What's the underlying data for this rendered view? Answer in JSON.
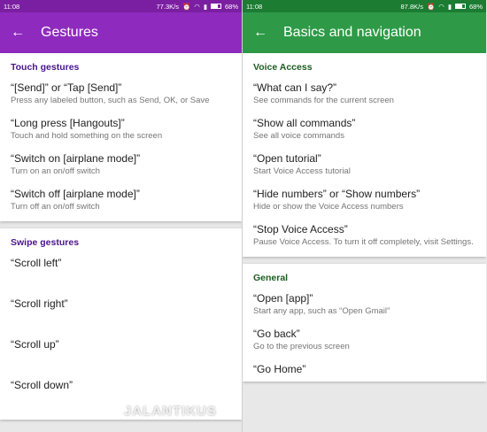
{
  "left": {
    "status": {
      "time": "11:08",
      "speed": "77.3K/s",
      "battery": "68%"
    },
    "title": "Gestures",
    "touch": {
      "header": "Touch gestures",
      "items": [
        {
          "cmd": "“[Send]” or “Tap [Send]”",
          "desc": "Press any labeled button, such as Send, OK, or Save"
        },
        {
          "cmd": "“Long press [Hangouts]”",
          "desc": "Touch and hold something on the screen"
        },
        {
          "cmd": "“Switch on [airplane mode]”",
          "desc": "Turn on an on/off switch"
        },
        {
          "cmd": "“Switch off [airplane mode]”",
          "desc": "Turn off an on/off switch"
        }
      ]
    },
    "swipe": {
      "header": "Swipe gestures",
      "items": [
        {
          "cmd": "“Scroll left”"
        },
        {
          "cmd": "“Scroll right”"
        },
        {
          "cmd": "“Scroll up”"
        },
        {
          "cmd": "“Scroll down”"
        }
      ]
    },
    "watermark": "JALANTIKUS"
  },
  "right": {
    "status": {
      "time": "11:08",
      "speed": "87.8K/s",
      "battery": "68%"
    },
    "title": "Basics and navigation",
    "voice": {
      "header": "Voice Access",
      "items": [
        {
          "cmd": "“What can I say?”",
          "desc": "See commands for the current screen"
        },
        {
          "cmd": "“Show all commands”",
          "desc": "See all voice commands"
        },
        {
          "cmd": "“Open tutorial”",
          "desc": "Start Voice Access tutorial"
        },
        {
          "cmd": "“Hide numbers” or “Show numbers”",
          "desc": "Hide or show the Voice Access numbers"
        },
        {
          "cmd": "“Stop Voice Access”",
          "desc": "Pause Voice Access. To turn it off completely, visit Settings."
        }
      ]
    },
    "general": {
      "header": "General",
      "items": [
        {
          "cmd": "“Open [app]”",
          "desc": "Start any app, such as “Open Gmail”"
        },
        {
          "cmd": "“Go back”",
          "desc": "Go to the previous screen"
        },
        {
          "cmd": "“Go Home”"
        }
      ]
    }
  },
  "colors": {
    "gestures_accent": "#8e2bbe",
    "basics_accent": "#2e9a47"
  },
  "icons": {
    "back": "arrow-back-icon",
    "wifi": "wifi-icon",
    "signal": "signal-icon",
    "battery": "battery-icon"
  }
}
